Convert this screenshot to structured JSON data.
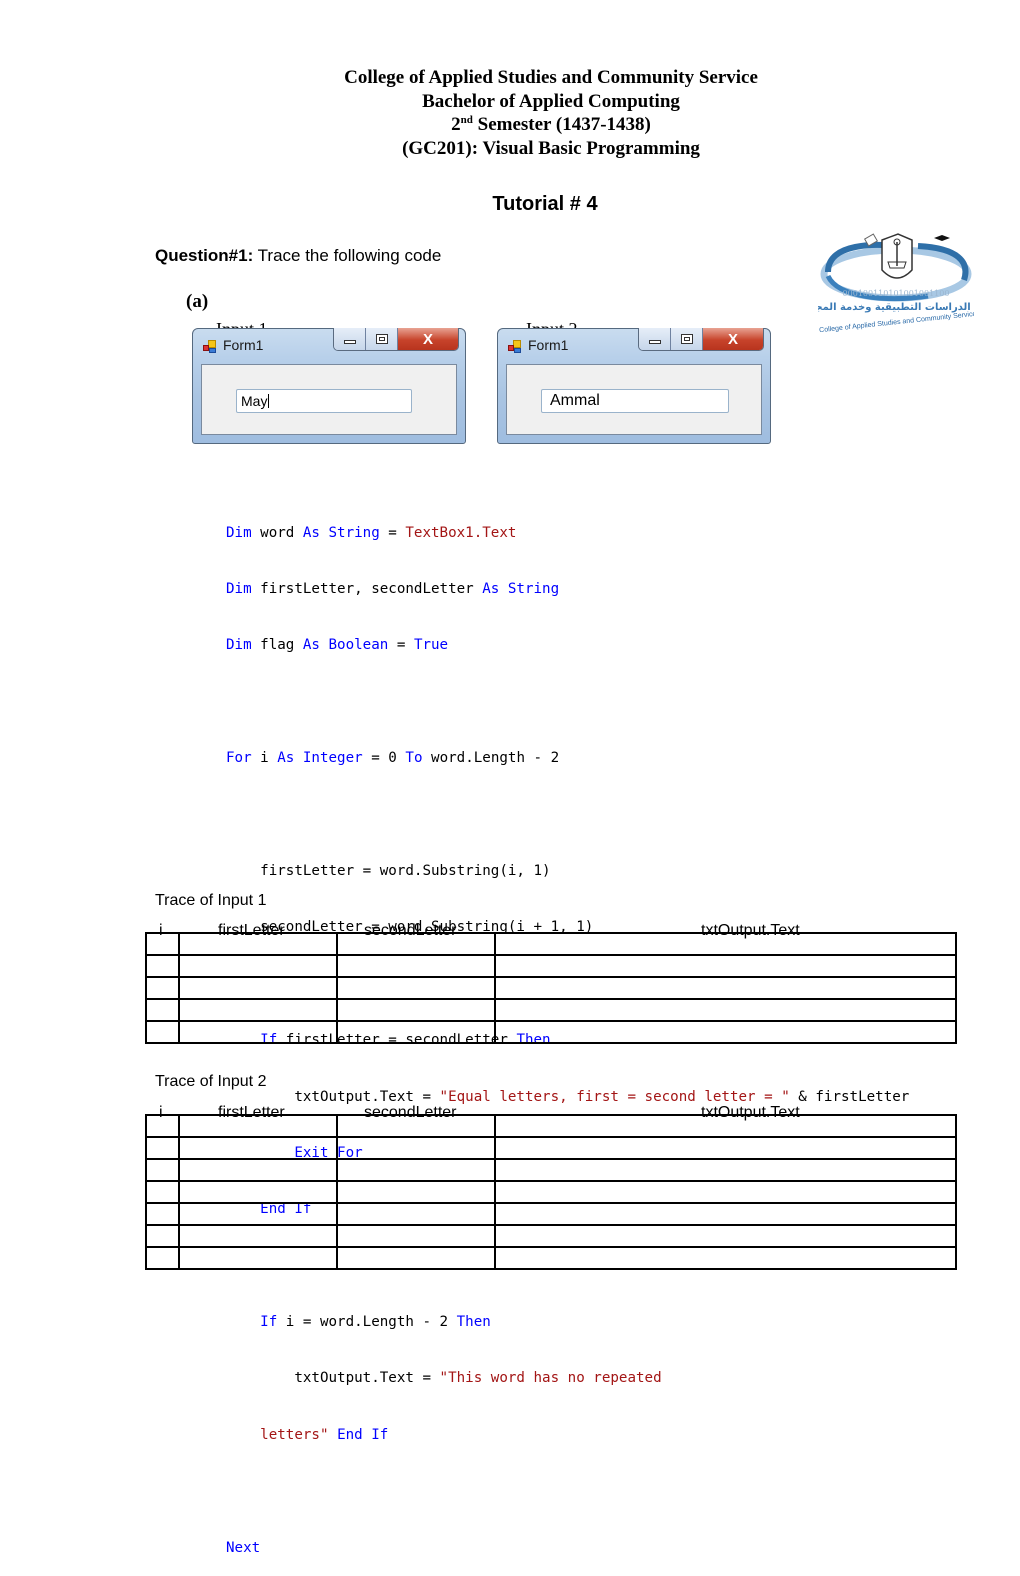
{
  "header": {
    "line1": "College of Applied Studies and Community Service",
    "line2": "Bachelor of Applied Computing",
    "line3_num": "2",
    "line3_sup": "nd",
    "line3_rest": " Semester (1437-1438)",
    "line4": "(GC201): Visual Basic Programming"
  },
  "title": "Tutorial # 4",
  "question": {
    "label": "Question#1:",
    "text": " Trace the following code"
  },
  "part_label": "(a)",
  "inputs": [
    {
      "caption": "Input 1",
      "window_title": "Form1",
      "textbox_value": "May"
    },
    {
      "caption": "Input 2",
      "window_title": "Form1",
      "textbox_value": "Ammal"
    }
  ],
  "window_buttons": {
    "close_glyph": "X"
  },
  "logo": {
    "binary": "000100110101001001100",
    "english": "College of Applied Studies and Community Service"
  },
  "code": {
    "l1": [
      "Dim",
      " word ",
      "As",
      " ",
      "String",
      " = ",
      "TextBox1.Text"
    ],
    "l2": [
      "Dim",
      " firstLetter, secondLetter ",
      "As",
      " ",
      "String"
    ],
    "l3": [
      "Dim",
      " flag ",
      "As",
      " ",
      "Boolean",
      " = ",
      "True"
    ],
    "l5": [
      "For",
      " i ",
      "As",
      " ",
      "Integer",
      " = 0 ",
      "To",
      " word.Length - 2"
    ],
    "l7": "    firstLetter = word.Substring(i, 1)",
    "l8": "    secondLetter = word.Substring(i + 1, 1)",
    "l10": [
      "    ",
      "If",
      " firstLetter = secondLetter ",
      "Then"
    ],
    "l11": [
      "        txtOutput.Text = ",
      "\"Equal letters, first = second letter = \"",
      " & firstLetter"
    ],
    "l12": [
      "        ",
      "Exit For"
    ],
    "l13": [
      "    ",
      "End If"
    ],
    "l15": [
      "    ",
      "If",
      " i = word.Length - 2 ",
      "Then"
    ],
    "l16": [
      "        txtOutput.Text = ",
      "\"This word has no repeated"
    ],
    "l17": [
      "    ",
      "letters\"",
      " ",
      "End If"
    ],
    "l19": "Next"
  },
  "colors": {
    "keyword": "#0000ff",
    "string": "#a31515"
  },
  "traces": [
    {
      "label": "Trace of Input 1",
      "columns": [
        "i",
        "firstLetter",
        "secondLetter",
        "txtOutput.Text"
      ],
      "rows": [
        [
          "",
          "",
          "",
          ""
        ],
        [
          "",
          "",
          "",
          ""
        ],
        [
          "",
          "",
          "",
          ""
        ],
        [
          "",
          "",
          "",
          ""
        ],
        [
          "",
          "",
          "",
          ""
        ]
      ]
    },
    {
      "label": "Trace of Input 2",
      "columns": [
        "i",
        "firstLetter",
        "secondLetter",
        "txtOutput.Text"
      ],
      "rows": [
        [
          "",
          "",
          "",
          ""
        ],
        [
          "",
          "",
          "",
          ""
        ],
        [
          "",
          "",
          "",
          ""
        ],
        [
          "",
          "",
          "",
          ""
        ],
        [
          "",
          "",
          "",
          ""
        ],
        [
          "",
          "",
          "",
          ""
        ],
        [
          "",
          "",
          "",
          ""
        ]
      ]
    }
  ]
}
